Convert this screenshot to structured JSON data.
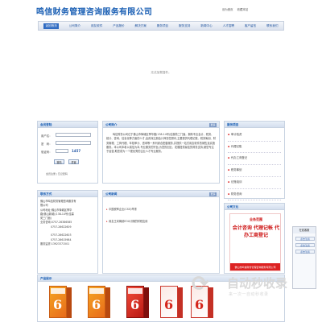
{
  "header": {
    "logo": "鸣信财务管理咨询服务有限公司",
    "top_links": [
      "设为首页",
      "收藏本站"
    ]
  },
  "nav": {
    "items": [
      {
        "label": "返回首页",
        "active": true
      },
      {
        "label": "公司简介",
        "active": false
      },
      {
        "label": "用友软件",
        "active": false
      },
      {
        "label": "产品报价",
        "active": false
      },
      {
        "label": "解决方案",
        "active": false
      },
      {
        "label": "服务项目",
        "active": false
      },
      {
        "label": "服务支持",
        "active": false
      },
      {
        "label": "新闻中心",
        "active": false
      },
      {
        "label": "人才招聘",
        "active": false
      },
      {
        "label": "客户留言",
        "active": false
      },
      {
        "label": "联系我们",
        "active": false
      }
    ]
  },
  "banner": {
    "message": "无法加载插件。"
  },
  "login": {
    "title": "会员登陆",
    "username_label": "用户名：",
    "password_label": "密　码：",
    "captcha_label": "验证码：",
    "captcha_code": "1457",
    "login_button": "登陆",
    "reset_button": "重置",
    "links": "会员注册 | 忘记密码"
  },
  "contact": {
    "title": "联系方式",
    "lines": [
      "佛山市鸣信财务管理咨询服务有",
      "限公司",
      "公司地址:佛山市禅城区季华",
      "路(佛山新城)(138-14号(佳霖",
      "苑三门面)",
      "业务咨询:0757-26386585",
      "0757-26622609",
      "",
      "0757-26622603",
      "0757-26615984",
      "服务监督:13923371501"
    ]
  },
  "intro": {
    "title": "公司简介",
    "more": "更多",
    "text": "鸣信财务公司位于佛山市禅城区季华路(138-14号)佳霖苑三门面。拥有专业会计、税务、统计、咨询、信息化等方面的人才,由资深注册会计师担任顾问,主要提供代理记账、税务筹划、财务管理、工商代理、年检审计、咨询等一系列综合配套服务,并提供一站式用友软件的销售及实施服务。本公司本着以诚信为本,专业服务的宗旨,为您的创业、发展提供最佳的财务支持,使您专注于经营,助您成为一个更优秀的企业人才专业服务。"
  },
  "news": {
    "title": "公司新闻",
    "more": "更多",
    "items": [
      "中国税率企业(CSO)举重",
      "用友王米铸就EOU计期的财税应用"
    ]
  },
  "services": {
    "title": "服务项目",
    "items": [
      "审计验资",
      "代理记账",
      "代办工商登记",
      "税务筹划",
      "记账培训",
      "财务咨询",
      "用友软件"
    ]
  },
  "culture": {
    "title": "公司文化",
    "badge": "业务范围",
    "headline": "会计咨询 代理记帐 代办工商登记",
    "footer": "佛山市鸣信财务管理咨询服务有限公司"
  },
  "online": {
    "title": "在线客服",
    "buttons": [
      "点击洽谈",
      "点击洽谈",
      "点击洽谈"
    ]
  },
  "products": {
    "title": "产品展示",
    "items": [
      {
        "label": "6",
        "style": "orange"
      },
      {
        "label": "6",
        "style": "orange"
      },
      {
        "label": "6",
        "style": "red"
      },
      {
        "label": "6",
        "style": "red2"
      },
      {
        "label": "6",
        "style": "red2"
      }
    ]
  },
  "watermark": {
    "brand": "自动秒收录",
    "tagline": "来一次一自动秒收录"
  },
  "colors": {
    "brand_blue": "#1a5fb4",
    "nav_active": "#2f6bc2",
    "accent_red": "#d22222"
  }
}
